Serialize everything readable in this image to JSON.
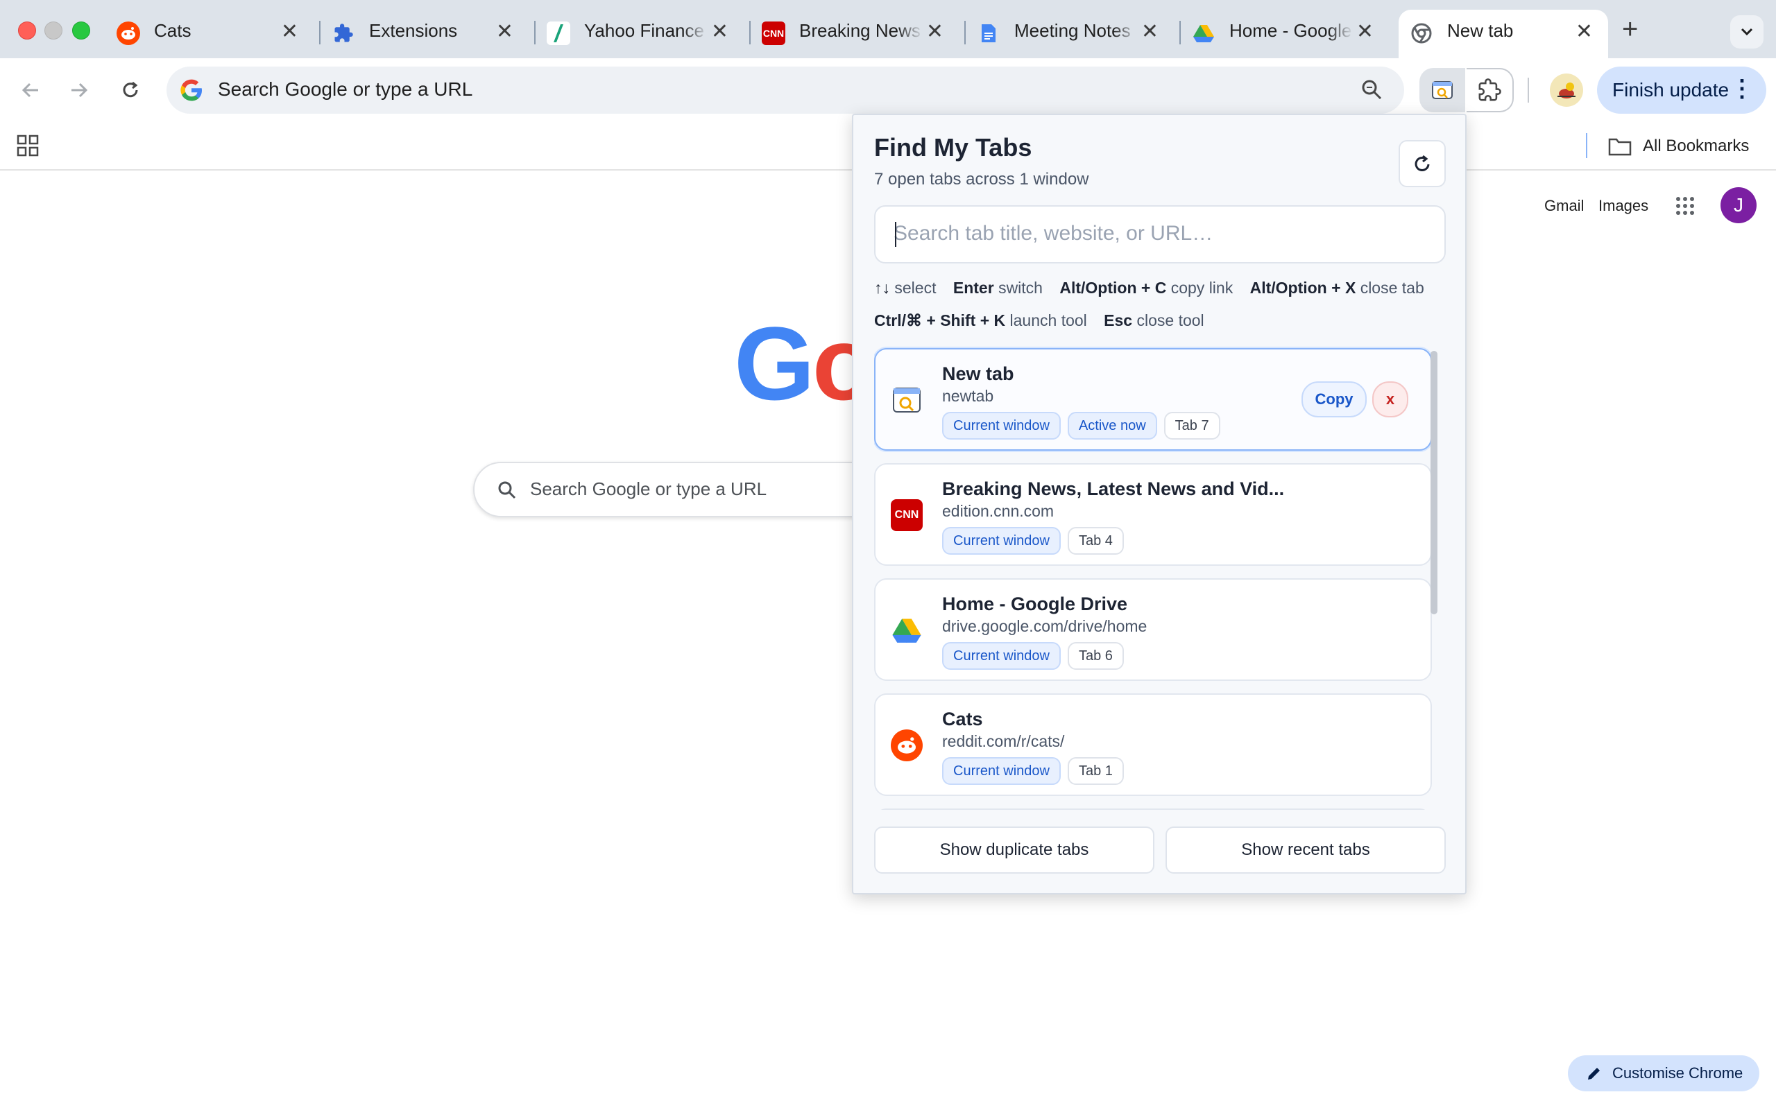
{
  "browser": {
    "tabs": [
      {
        "title": "Cats",
        "icon": "reddit-icon"
      },
      {
        "title": "Extensions",
        "icon": "puzzle-icon"
      },
      {
        "title": "Yahoo Finance",
        "icon": "yahoo-finance-icon"
      },
      {
        "title": "Breaking News",
        "icon": "cnn-icon"
      },
      {
        "title": "Meeting Notes",
        "icon": "google-docs-icon"
      },
      {
        "title": "Home - Google",
        "icon": "google-drive-icon"
      },
      {
        "title": "New tab",
        "icon": "chrome-icon"
      }
    ],
    "new_tab_glyph": "+",
    "omnibox": {
      "placeholder": "Search Google or type a URL"
    },
    "finish_update_label": "Finish update",
    "bookmarks": {
      "all_bookmarks_label": "All Bookmarks"
    }
  },
  "newtab_page": {
    "gmail_label": "Gmail",
    "images_label": "Images",
    "avatar_initial": "J",
    "search_placeholder": "Search Google or type a URL",
    "customise_label": "Customise Chrome"
  },
  "popup": {
    "title": "Find My Tabs",
    "subtitle": "7 open tabs across 1 window",
    "search_placeholder": "Search tab title, website, or URL…",
    "hints_row1": [
      {
        "key": "↑↓",
        "desc": "select"
      },
      {
        "key": "Enter",
        "desc": "switch"
      },
      {
        "key": "Alt/Option + C",
        "desc": "copy link"
      },
      {
        "key": "Alt/Option + X",
        "desc": "close tab"
      }
    ],
    "hints_row2": [
      {
        "key": "Ctrl/⌘ + Shift + K",
        "desc": "launch tool"
      },
      {
        "key": "Esc",
        "desc": "close tool"
      }
    ],
    "results": [
      {
        "title": "New tab",
        "url": "newtab",
        "chips": [
          "Current window",
          "Active now"
        ],
        "tab_label": "Tab 7",
        "icon": "newtab-search-icon"
      },
      {
        "title": "Breaking News, Latest News and Vid...",
        "url": "edition.cnn.com",
        "chips": [
          "Current window"
        ],
        "tab_label": "Tab 4",
        "icon": "cnn-icon"
      },
      {
        "title": "Home - Google Drive",
        "url": "drive.google.com/drive/home",
        "chips": [
          "Current window"
        ],
        "tab_label": "Tab 6",
        "icon": "google-drive-icon"
      },
      {
        "title": "Cats",
        "url": "reddit.com/r/cats/",
        "chips": [
          "Current window"
        ],
        "tab_label": "Tab 1",
        "icon": "reddit-icon"
      }
    ],
    "copy_label": "Copy",
    "close_label": "x",
    "show_duplicates_label": "Show duplicate tabs",
    "show_recent_label": "Show recent tabs"
  },
  "colors": {
    "tabstrip_bg": "#dde3ea",
    "accent_blue": "#1a57c9",
    "finish_update_bg": "#d3e3fd",
    "avatar_purple": "#7b1fa2"
  }
}
